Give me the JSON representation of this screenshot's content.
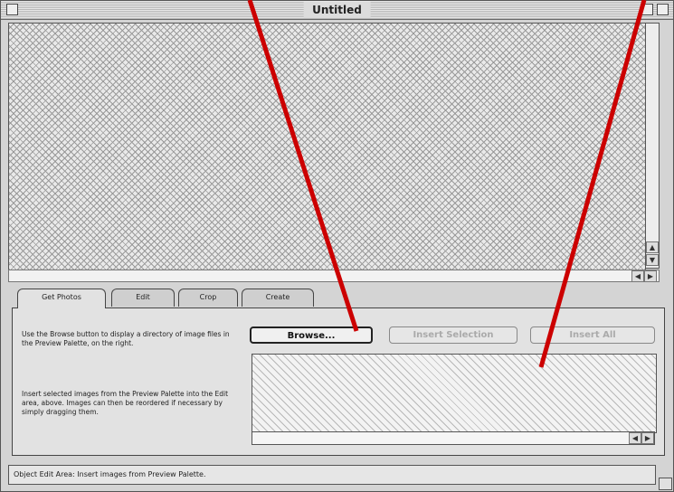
{
  "window": {
    "title": "Untitled"
  },
  "tabs": [
    {
      "label": "Get Photos",
      "active": true
    },
    {
      "label": "Edit"
    },
    {
      "label": "Crop"
    },
    {
      "label": "Create"
    }
  ],
  "panel": {
    "description_1": "Use the Browse button to display a directory of image files in the Preview Palette, on the right.",
    "description_2": "Insert selected images from the Preview Palette into the Edit area, above. Images can then be reordered if necessary by simply dragging them.",
    "browse_label": "Browse...",
    "insert_selection_label": "Insert Selection",
    "insert_all_label": "Insert All"
  },
  "status": {
    "text": "Object Edit Area:  Insert images from Preview Palette."
  },
  "icons": {
    "scroll_up": "▲",
    "scroll_down": "▼",
    "scroll_left": "◀",
    "scroll_right": "▶"
  },
  "colors": {
    "annotation_arrow": "#cc0000"
  }
}
